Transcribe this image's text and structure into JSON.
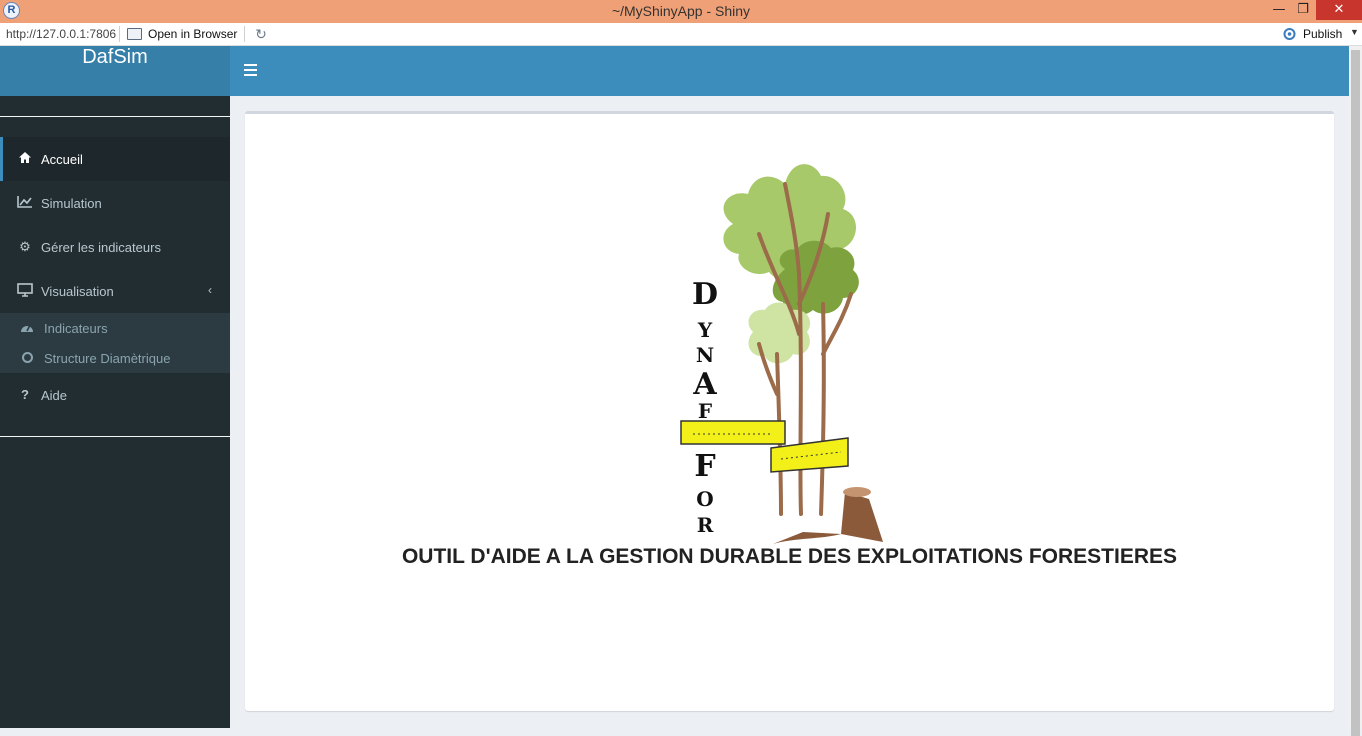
{
  "window": {
    "title": "~/MyShinyApp - Shiny",
    "min_glyph": "—",
    "max_glyph": "❐",
    "close_glyph": "✕"
  },
  "toolbar": {
    "url": "http://127.0.0.1:7806",
    "open_in_browser": "Open in Browser",
    "publish": "Publish"
  },
  "app": {
    "brand": "DafSim"
  },
  "sidebar": {
    "items": [
      {
        "label": "Accueil",
        "icon": "home-icon"
      },
      {
        "label": "Simulation",
        "icon": "line-chart-icon"
      },
      {
        "label": "Gérer les indicateurs",
        "icon": "cog-icon"
      },
      {
        "label": "Visualisation",
        "icon": "desktop-icon"
      },
      {
        "label": "Aide",
        "icon": "question-icon"
      }
    ],
    "subitems": [
      {
        "label": "Indicateurs",
        "icon": "dashboard-icon"
      },
      {
        "label": "Structure Diamètrique",
        "icon": "circle-o-icon"
      }
    ]
  },
  "main": {
    "logo_letters": [
      "D",
      "Y",
      "N",
      "A",
      "F",
      "F",
      "O",
      "R"
    ],
    "headline": "OUTIL D'AIDE A LA GESTION DURABLE DES EXPLOITATIONS FORESTIERES"
  },
  "colors": {
    "title_bar": "#f0a076",
    "header": "#3c8dbc",
    "brand": "#367fa9",
    "sidebar": "#222d32",
    "content_bg": "#ecf0f5"
  }
}
